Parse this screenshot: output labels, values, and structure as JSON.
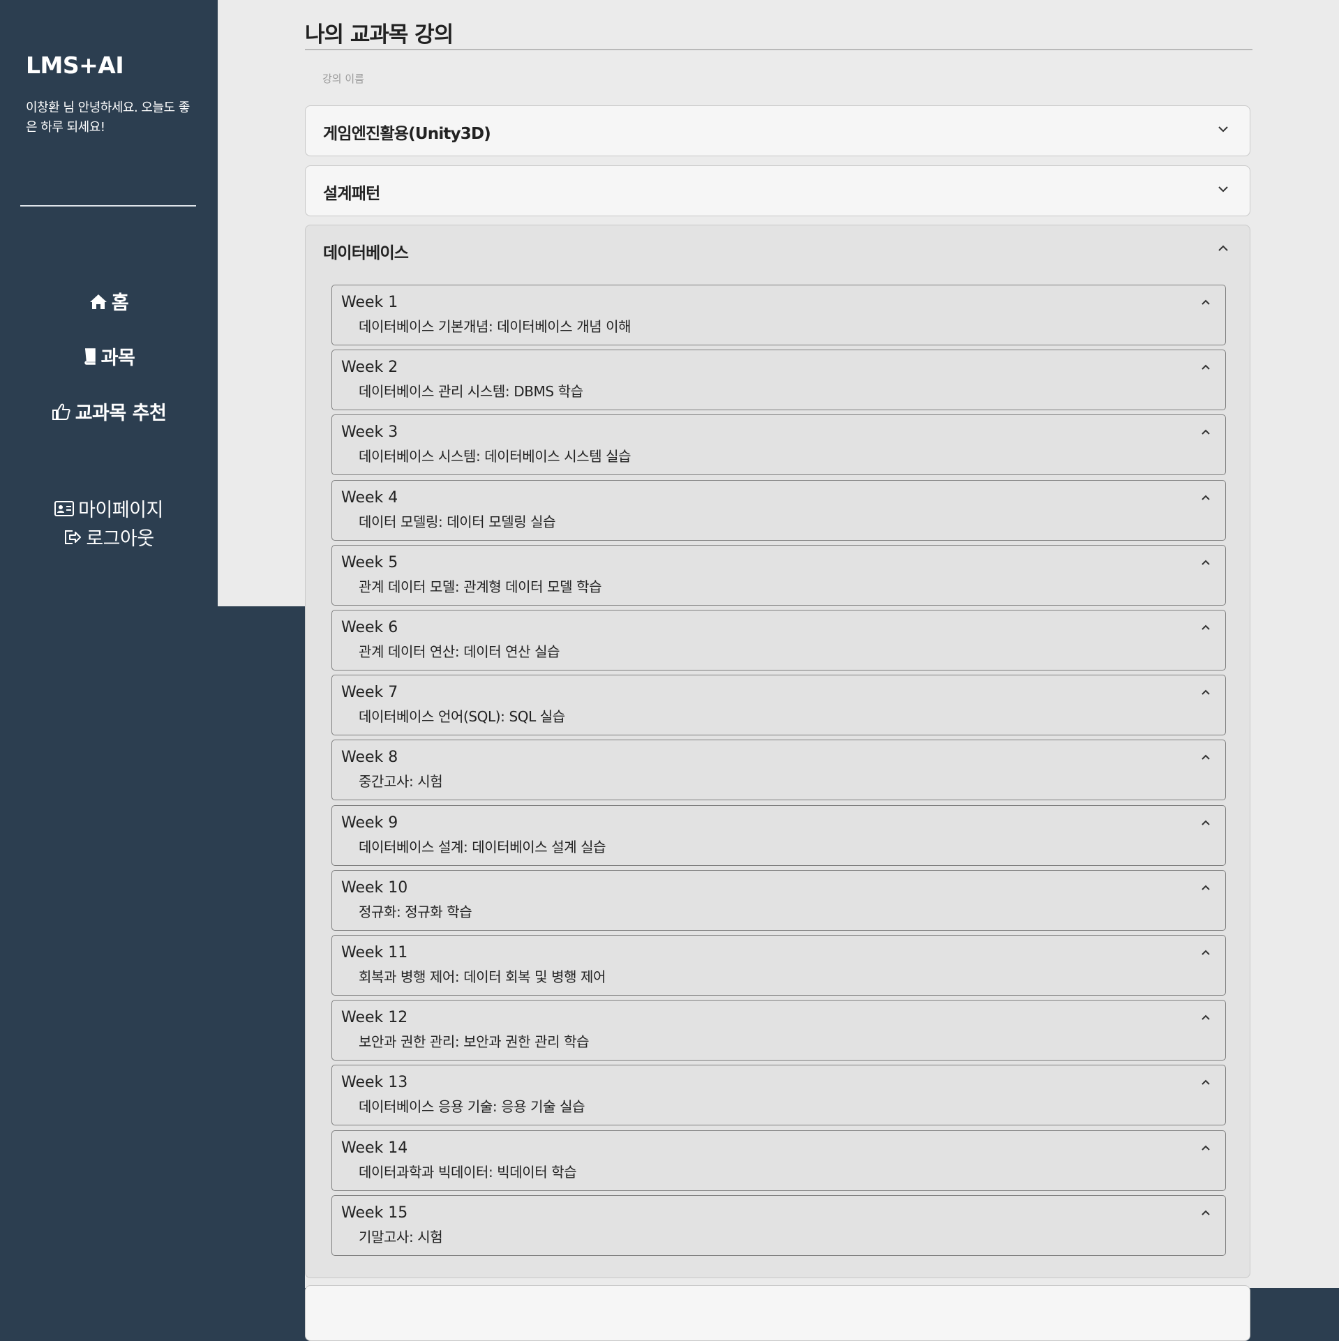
{
  "sidebar": {
    "brand": "LMS+AI",
    "greeting": "이창환 님 안녕하세요. 오늘도 좋은 하루 되세요!",
    "nav": {
      "home": {
        "label": "홈",
        "icon": "home-icon"
      },
      "course": {
        "label": "과목",
        "icon": "book-icon"
      },
      "recommend": {
        "label": "교과목 추천",
        "icon": "thumbs-up-icon"
      },
      "mypage": {
        "label": "마이페이지",
        "icon": "id-card-icon"
      },
      "logout": {
        "label": "로그아웃",
        "icon": "logout-icon"
      }
    }
  },
  "main": {
    "title": "나의 교과목 강의",
    "column_label": "강의 이름",
    "courses": [
      {
        "name": "게임엔진활용(Unity3D)",
        "expanded": false
      },
      {
        "name": "설계패턴",
        "expanded": false
      },
      {
        "name": "데이터베이스",
        "expanded": true,
        "weeks": [
          {
            "label": "Week 1",
            "topic": "데이터베이스 기본개념: 데이터베이스 개념 이해"
          },
          {
            "label": "Week 2",
            "topic": "데이터베이스 관리 시스템: DBMS 학습"
          },
          {
            "label": "Week 3",
            "topic": "데이터베이스 시스템: 데이터베이스 시스템 실습"
          },
          {
            "label": "Week 4",
            "topic": "데이터 모델링: 데이터 모델링 실습"
          },
          {
            "label": "Week 5",
            "topic": "관계 데이터 모델: 관계형 데이터 모델 학습"
          },
          {
            "label": "Week 6",
            "topic": "관계 데이터 연산: 데이터 연산 실습"
          },
          {
            "label": "Week 7",
            "topic": "데이터베이스 언어(SQL): SQL 실습"
          },
          {
            "label": "Week 8",
            "topic": "중간고사: 시험"
          },
          {
            "label": "Week 9",
            "topic": "데이터베이스 설계: 데이터베이스 설계 실습"
          },
          {
            "label": "Week 10",
            "topic": "정규화: 정규화 학습"
          },
          {
            "label": "Week 11",
            "topic": "회복과 병행 제어: 데이터 회복 및 병행 제어"
          },
          {
            "label": "Week 12",
            "topic": "보안과 권한 관리: 보안과 권한 관리 학습"
          },
          {
            "label": "Week 13",
            "topic": "데이터베이스 응용 기술: 응용 기술 실습"
          },
          {
            "label": "Week 14",
            "topic": "데이터과학과 빅데이터: 빅데이터 학습"
          },
          {
            "label": "Week 15",
            "topic": "기말고사: 시험"
          }
        ]
      }
    ]
  },
  "colors": {
    "sidebar_bg": "#2c3e50",
    "content_bg": "#ebebeb",
    "card_bg": "#f6f6f6",
    "expanded_bg": "#e3e3e3"
  }
}
